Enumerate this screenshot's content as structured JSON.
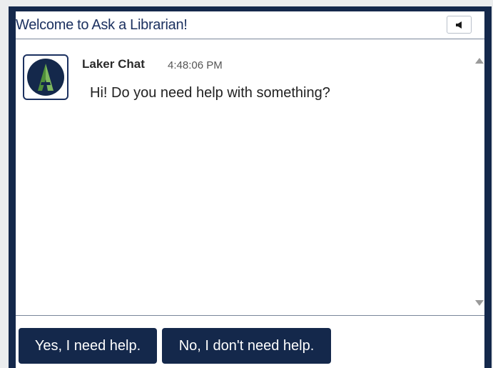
{
  "header": {
    "title": "Welcome to Ask a Librarian!",
    "sound_icon": "speaker-icon"
  },
  "transcript": {
    "messages": [
      {
        "sender": "Laker Chat",
        "time": "4:48:06 PM",
        "text": "Hi! Do you need help with something?",
        "avatar_icon": "laker-logo-icon"
      }
    ]
  },
  "actions": {
    "yes_label": "Yes, I need help.",
    "no_label": "No, I don't need help."
  },
  "colors": {
    "brand_navy": "#14284b",
    "title_blue": "#1c3160",
    "logo_green": "#4f8f3a",
    "page_bg": "#ebedee"
  }
}
